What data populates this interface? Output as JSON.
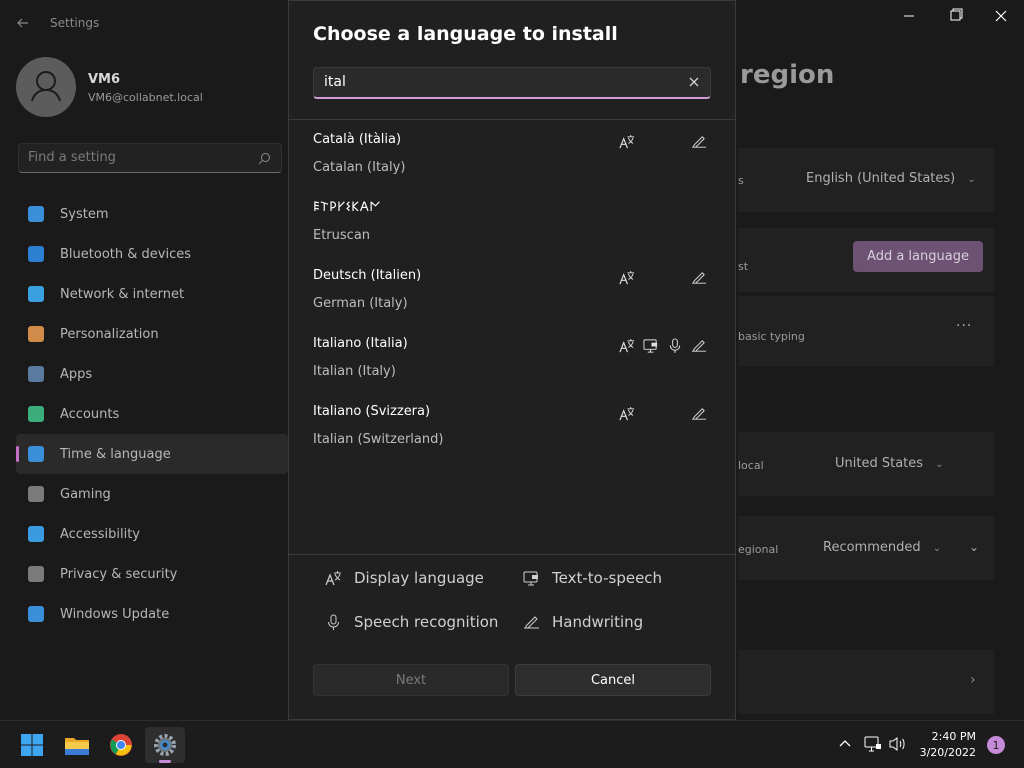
{
  "settings": {
    "title": "Settings",
    "user": {
      "name": "VM6",
      "email": "VM6@collabnet.local"
    },
    "search_placeholder": "Find a setting",
    "nav": [
      {
        "label": "System",
        "color": "#3a8fd8"
      },
      {
        "label": "Bluetooth & devices",
        "color": "#2d7fd1"
      },
      {
        "label": "Network & internet",
        "color": "#3aa0e0"
      },
      {
        "label": "Personalization",
        "color": "#d08a4a"
      },
      {
        "label": "Apps",
        "color": "#5a7aa0"
      },
      {
        "label": "Accounts",
        "color": "#3cae7c"
      },
      {
        "label": "Time & language",
        "color": "#3a8fd8",
        "selected": true
      },
      {
        "label": "Gaming",
        "color": "#7a7a7a"
      },
      {
        "label": "Accessibility",
        "color": "#3a9be0"
      },
      {
        "label": "Privacy & security",
        "color": "#7a7a7a"
      },
      {
        "label": "Windows Update",
        "color": "#3a8fd8"
      }
    ],
    "page_title": "region",
    "windows_display_language": "English (United States)",
    "add_language_label": "Add a language",
    "basic_typing_fragment": "basic typing",
    "list_fragment": "st",
    "s_fragment": "s",
    "country_label_fragment": "local",
    "country_value": "United States",
    "regional_format_fragment": "egional",
    "regional_format_value": "Recommended"
  },
  "dialog": {
    "title": "Choose a language to install",
    "search_value": "ital",
    "languages": [
      {
        "native": "Català (Itàlia)",
        "english": "Catalan (Italy)",
        "features": [
          "display-language",
          "handwriting"
        ]
      },
      {
        "native": "𐌄𐌕𐌓𐌖𐌔𐌊𐌀𐌍",
        "english": "Etruscan",
        "features": []
      },
      {
        "native": "Deutsch (Italien)",
        "english": "German (Italy)",
        "features": [
          "display-language",
          "handwriting"
        ]
      },
      {
        "native": "Italiano (Italia)",
        "english": "Italian (Italy)",
        "features": [
          "display-language",
          "text-to-speech",
          "speech-recognition",
          "handwriting"
        ]
      },
      {
        "native": "Italiano (Svizzera)",
        "english": "Italian (Switzerland)",
        "features": [
          "display-language",
          "handwriting"
        ]
      }
    ],
    "legend": {
      "display_language": "Display language",
      "text_to_speech": "Text-to-speech",
      "speech_recognition": "Speech recognition",
      "handwriting": "Handwriting"
    },
    "next_label": "Next",
    "cancel_label": "Cancel"
  },
  "taskbar": {
    "time": "2:40 PM",
    "date": "3/20/2022",
    "notification_count": "1"
  }
}
